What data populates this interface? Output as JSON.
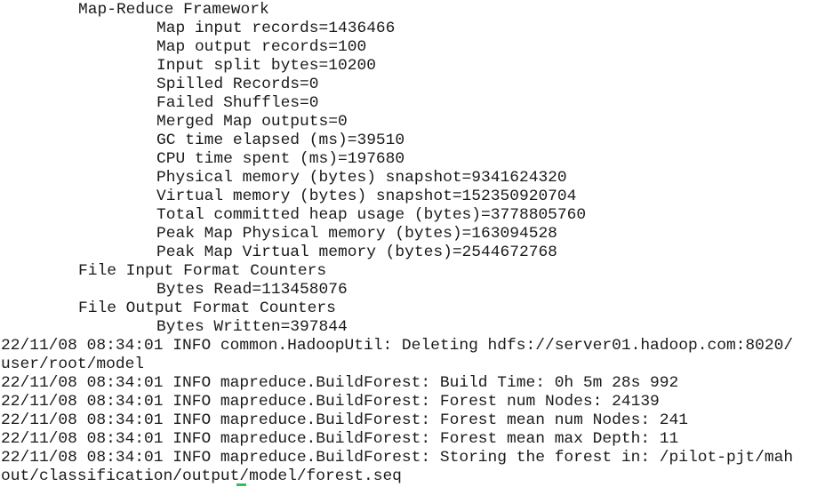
{
  "terminal": {
    "lines": [
      {
        "text": "Map-Reduce Framework",
        "indent": 1
      },
      {
        "text": "Map input records=1436466",
        "indent": 2
      },
      {
        "text": "Map output records=100",
        "indent": 2
      },
      {
        "text": "Input split bytes=10200",
        "indent": 2
      },
      {
        "text": "Spilled Records=0",
        "indent": 2
      },
      {
        "text": "Failed Shuffles=0",
        "indent": 2
      },
      {
        "text": "Merged Map outputs=0",
        "indent": 2
      },
      {
        "text": "GC time elapsed (ms)=39510",
        "indent": 2
      },
      {
        "text": "CPU time spent (ms)=197680",
        "indent": 2
      },
      {
        "text": "Physical memory (bytes) snapshot=9341624320",
        "indent": 2
      },
      {
        "text": "Virtual memory (bytes) snapshot=152350920704",
        "indent": 2
      },
      {
        "text": "Total committed heap usage (bytes)=3778805760",
        "indent": 2
      },
      {
        "text": "Peak Map Physical memory (bytes)=163094528",
        "indent": 2
      },
      {
        "text": "Peak Map Virtual memory (bytes)=2544672768",
        "indent": 2
      },
      {
        "text": "File Input Format Counters",
        "indent": 1
      },
      {
        "text": "Bytes Read=113458076",
        "indent": 2
      },
      {
        "text": "File Output Format Counters",
        "indent": 1
      },
      {
        "text": "Bytes Written=397844",
        "indent": 2
      },
      {
        "text": "22/11/08 08:34:01 INFO common.HadoopUtil: Deleting hdfs://server01.hadoop.com:8020/",
        "indent": 0
      },
      {
        "text": "user/root/model",
        "indent": 0
      },
      {
        "text": "22/11/08 08:34:01 INFO mapreduce.BuildForest: Build Time: 0h 5m 28s 992",
        "indent": 0
      },
      {
        "text": "22/11/08 08:34:01 INFO mapreduce.BuildForest: Forest num Nodes: 24139",
        "indent": 0
      },
      {
        "text": "22/11/08 08:34:01 INFO mapreduce.BuildForest: Forest mean num Nodes: 241",
        "indent": 0
      },
      {
        "text": "22/11/08 08:34:01 INFO mapreduce.BuildForest: Forest mean max Depth: 11",
        "indent": 0
      },
      {
        "text": "22/11/08 08:34:01 INFO mapreduce.BuildForest: Storing the forest in: /pilot-pjt/mah",
        "indent": 0
      },
      {
        "text": "out/classification/output/model/forest.seq",
        "indent": 0
      }
    ]
  },
  "colors": {
    "background": "#ffffff",
    "text": "#1a1a1a",
    "cursor": "#2fbf5f"
  }
}
